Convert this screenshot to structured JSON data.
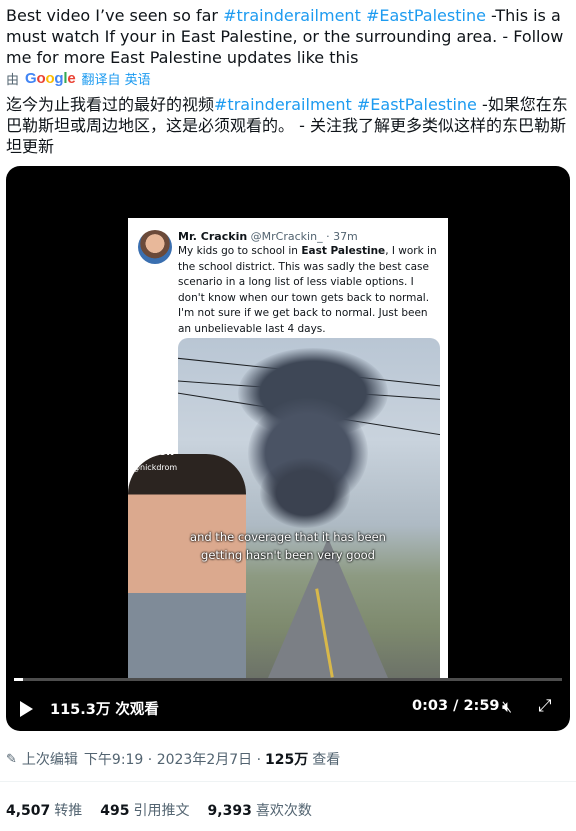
{
  "tweet": {
    "text_a": "Best video I’ve seen so far ",
    "hashtag_1": "#trainderailment",
    "hashtag_2": "#EastPalestine",
    "text_b": " -This is a must watch If your in East Palestine, or the surrounding area. - Follow me for more East Palestine updates like this"
  },
  "translation": {
    "by": "由",
    "logo_g": "G",
    "logo_o1": "o",
    "logo_o2": "o",
    "logo_g2": "g",
    "logo_l": "l",
    "logo_e": "e",
    "link": "翻译自 英语",
    "text_a": "迄今为止我看过的最好的视频",
    "hashtag_1": "#trainderailment",
    "hashtag_2": "#EastPalestine",
    "text_b": " -如果您在东巴勒斯坦或周边地区，这是必须观看的。 - 关注我了解更多类似这样的东巴勒斯坦更新"
  },
  "video": {
    "inner_name": "Mr. Crackin",
    "inner_handle": "@MrCrackin_ · 37m",
    "inner_text_a": "My kids go to school in ",
    "inner_text_bold": "East Palestine",
    "inner_text_b": ", I work in the school district. This was sadly the best case scenario in a long list of less viable options. I don't know when our town gets back to normal. I'm not sure if we get back to normal. Just been an unbelievable last 4 days.",
    "tiktok_label": "TikTok",
    "tiktok_user": "@nickdrom",
    "caption": "and the coverage that it has been getting hasn't been very good",
    "views": "115.3万 次观看",
    "time": "0:03 / 2:59",
    "progress": 0.017
  },
  "meta": {
    "edited": "上次编辑",
    "timestamp": "下午9:19 · 2023年2月7日 ·",
    "view_count": "125万",
    "view_label": "查看"
  },
  "stats": {
    "retweets": "4,507",
    "retweets_label": "转推",
    "quotes": "495",
    "quotes_label": "引用推文",
    "likes": "9,393",
    "likes_label": "喜欢次数"
  },
  "colors": {
    "link": "#1d9bf0",
    "muted": "#536471"
  },
  "icons": [
    "play-icon",
    "mute-icon",
    "fullscreen-icon",
    "pencil-icon",
    "tiktok-icon"
  ]
}
